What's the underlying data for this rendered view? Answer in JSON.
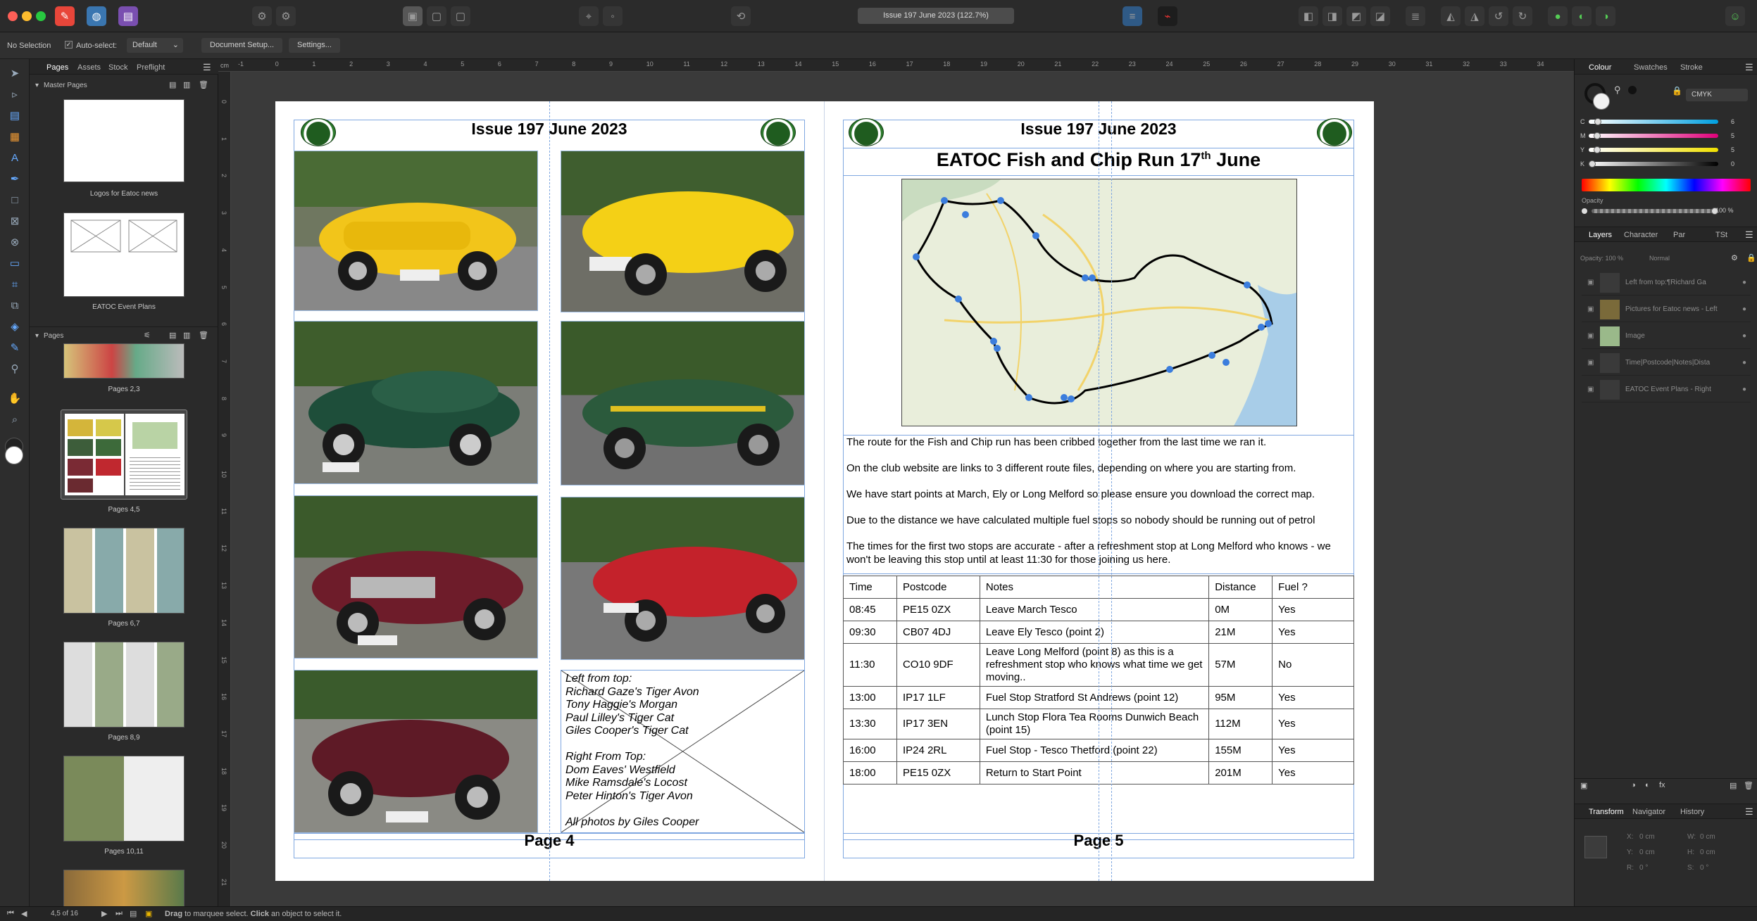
{
  "window": {
    "title": "Issue 197 June 2023 (122.7%)"
  },
  "colors": {
    "accent": "#2a82da",
    "page": "#ffffff",
    "canvas": "#3a3a3a",
    "panel": "#2b2b2b",
    "guide": "#7fa7e0",
    "logo_green": "#1f5c1f"
  },
  "context": {
    "selection": "No Selection",
    "autoselect_label": "Auto-select:",
    "autoselect_value": "Default",
    "doc_setup": "Document Setup...",
    "settings": "Settings..."
  },
  "ruler": {
    "unit": "cm",
    "h_ticks": [
      "-1",
      "0",
      "1",
      "2",
      "3",
      "4",
      "5",
      "6",
      "7",
      "8",
      "9",
      "10",
      "11",
      "12",
      "13",
      "14",
      "15",
      "16",
      "17",
      "18",
      "19",
      "20",
      "21",
      "22",
      "23",
      "24",
      "25",
      "26",
      "27",
      "28",
      "29",
      "30",
      "31",
      "32",
      "33",
      "34"
    ],
    "v_ticks": [
      "0",
      "1",
      "2",
      "3",
      "4",
      "5",
      "6",
      "7",
      "8",
      "9",
      "10",
      "11",
      "12",
      "13",
      "14",
      "15",
      "16",
      "17",
      "18",
      "19",
      "20",
      "21"
    ]
  },
  "pages_panel": {
    "tabs": [
      "Pages",
      "Assets",
      "Stock",
      "Preflight"
    ],
    "master_header": "Master Pages",
    "masters": [
      "Logos for Eatoc news",
      "EATOC Event Plans"
    ],
    "pages_header": "Pages",
    "pages": [
      "Pages 2,3",
      "Pages 4,5",
      "Pages 6,7",
      "Pages 8,9",
      "Pages 10,11"
    ]
  },
  "page4": {
    "header": "Issue 197 June 2023",
    "caption_lines": [
      "Left from top:",
      "Richard Gaze's Tiger Avon",
      "Tony Haggie's Morgan",
      "Paul Lilley's Tiger Cat",
      "Giles Cooper's Tiger Cat",
      "",
      "Right From Top:",
      "Dom Eaves' Westfield",
      "Mike Ramsdale's Locost",
      "Peter Hinton's Tiger Avon",
      "",
      "All photos by Giles Cooper"
    ],
    "footer": "Page 4"
  },
  "page5": {
    "header": "Issue 197 June 2023",
    "title_main": "EATOC Fish and Chip Run 17",
    "title_sup": "th",
    "title_end": " June",
    "paragraphs": [
      "The route for the Fish and Chip run has been cribbed together from the last time we ran it.",
      "On the club website are links to 3 different route files, depending on where you are starting from.",
      "We have start points at March, Ely or Long Melford so please ensure you download the correct map.",
      "Due to the distance we have calculated multiple fuel stops so nobody should be running out of petrol",
      "The times for the first two stops are accurate - after a refreshment stop at Long Melford who knows - we won't be leaving this stop until at least 11:30 for those joining us here."
    ],
    "table": {
      "headers": [
        "Time",
        "Postcode",
        "Notes",
        "Distance",
        "Fuel ?"
      ],
      "rows": [
        [
          "08:45",
          "PE15 0ZX",
          "Leave March Tesco",
          "0M",
          "Yes"
        ],
        [
          "09:30",
          "CB07 4DJ",
          "Leave Ely Tesco (point 2)",
          "21M",
          "Yes"
        ],
        [
          "11:30",
          "CO10 9DF",
          "Leave Long Melford (point 8) as this is a refreshment stop who knows what time we get moving..",
          "57M",
          "No"
        ],
        [
          "13:00",
          "IP17 1LF",
          "Fuel Stop Stratford St Andrews (point 12)",
          "95M",
          "Yes"
        ],
        [
          "13:30",
          "IP17 3EN",
          "Lunch Stop Flora Tea Rooms Dunwich Beach (point 15)",
          "112M",
          "Yes"
        ],
        [
          "16:00",
          "IP24 2RL",
          "Fuel Stop - Tesco Thetford (point 22)",
          "155M",
          "Yes"
        ],
        [
          "18:00",
          "PE15 0ZX",
          "Return to Start Point",
          "201M",
          "Yes"
        ]
      ]
    },
    "footer": "Page 5"
  },
  "right_panel": {
    "tabs": [
      "Colour",
      "Swatches",
      "Stroke"
    ],
    "mode": "CMYK",
    "channels": [
      {
        "name": "C",
        "value": "6"
      },
      {
        "name": "M",
        "value": "5"
      },
      {
        "name": "Y",
        "value": "5"
      },
      {
        "name": "K",
        "value": "0"
      }
    ],
    "opacity_label": "Opacity",
    "opacity_value": "100 %",
    "layers_tabs": [
      "Layers",
      "Character",
      "Par",
      "TSt"
    ],
    "layers_opacity": "Opacity: 100 %",
    "blend": "Normal",
    "layers": [
      "Left from top:¶Richard Ga",
      "Pictures for Eatoc news - Left",
      "Image",
      "Time|Postcode|Notes|Dista",
      "EATOC Event Plans - Right"
    ],
    "transform_tabs": [
      "Transform",
      "Navigator",
      "History"
    ],
    "transform": {
      "x": "0 cm",
      "y": "0 cm",
      "w": "0 cm",
      "h": "0 cm",
      "r": "0 °",
      "s": "0 °"
    }
  },
  "status": {
    "page_info": "4,5 of 16",
    "hint_a": "Drag",
    "hint_b": " to marquee select. ",
    "hint_c": "Click",
    "hint_d": " an object to select it."
  }
}
